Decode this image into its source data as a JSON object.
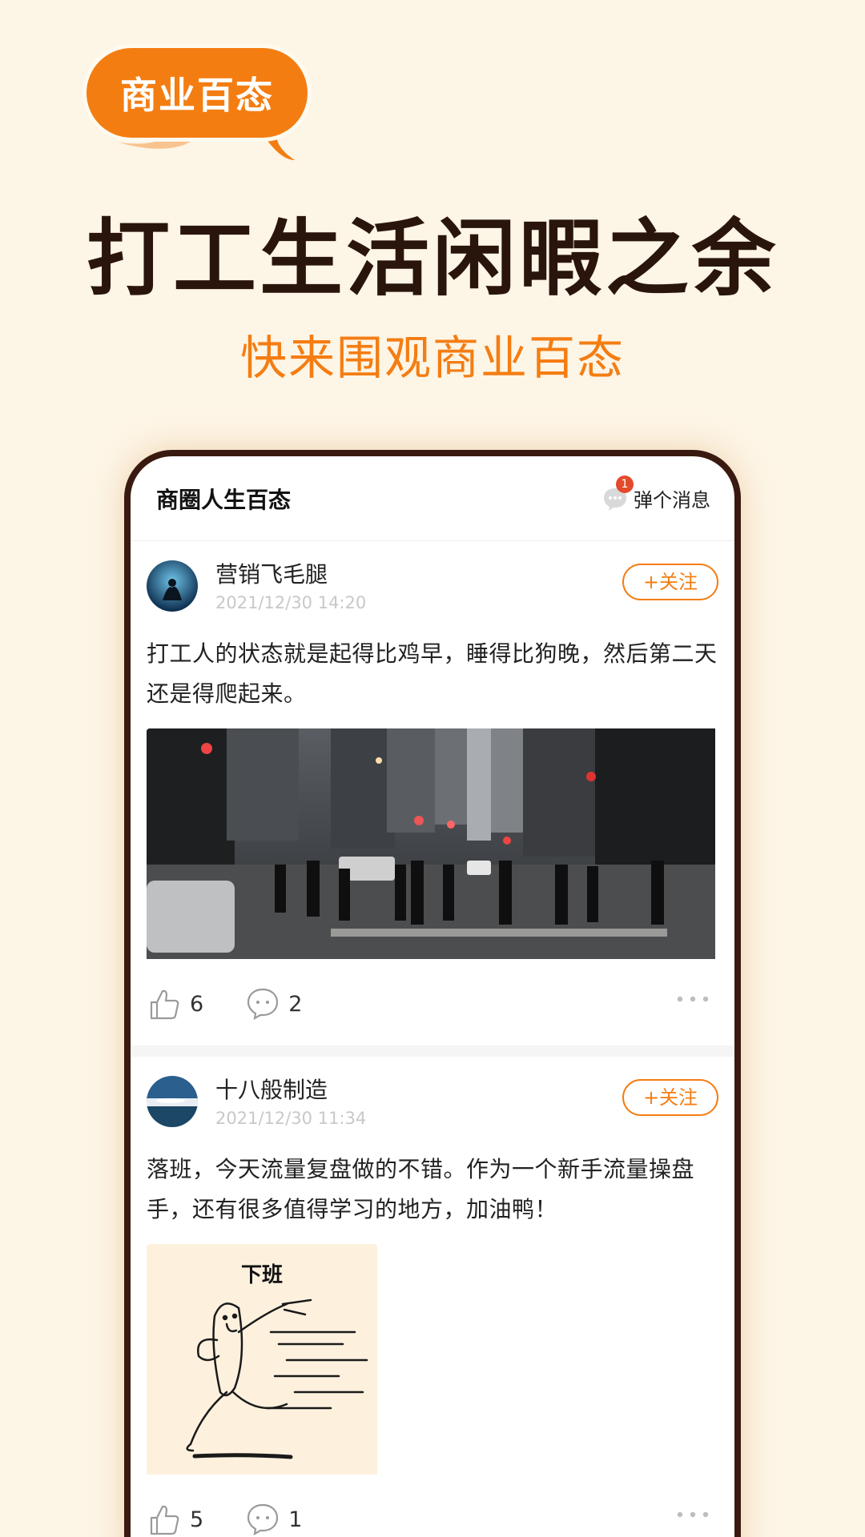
{
  "hero": {
    "badge": "商业百态",
    "headline": "打工生活闲暇之余",
    "subheadline": "快来围观商业百态"
  },
  "colors": {
    "background": "#fdf5e6",
    "accent": "#f47d12",
    "headline": "#2a150d",
    "phone_frame": "#3a1a10"
  },
  "app": {
    "title": "商圈人生百态",
    "message_label": "弹个消息",
    "message_badge": "1",
    "message_icon": "chat-bubble-icon"
  },
  "posts": [
    {
      "author": "营销飞毛腿",
      "time": "2021/12/30 14:20",
      "follow_label": "+关注",
      "text": "打工人的状态就是起得比鸡早，睡得比狗晚，然后第二天还是得爬起来。",
      "image": "city-crosswalk-photo",
      "likes": "6",
      "comments": "2"
    },
    {
      "author": "十八般制造",
      "time": "2021/12/30 11:34",
      "follow_label": "+关注",
      "text": "落班，今天流量复盘做的不错。作为一个新手流量操盘手，还有很多值得学习的地方，加油鸭！",
      "image": "off-work-meme",
      "image_caption": "下班",
      "likes": "5",
      "comments": "1"
    }
  ]
}
